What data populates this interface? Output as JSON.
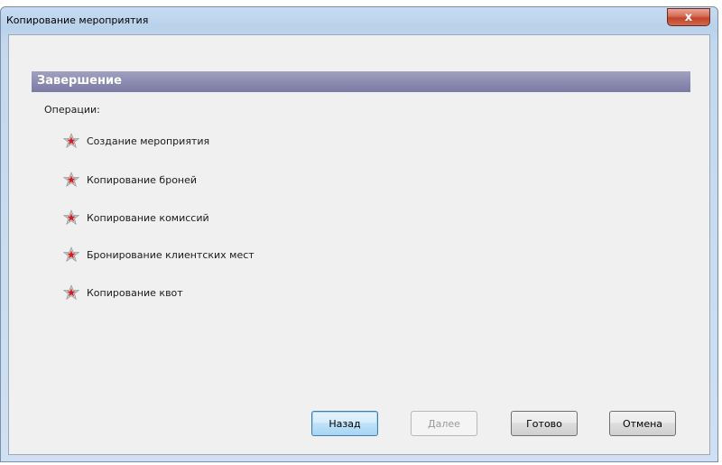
{
  "window": {
    "title": "Копирование мероприятия",
    "close_icon": "close-icon",
    "close_label": "x"
  },
  "page": {
    "header": "Завершение",
    "operations_label": "Операции:",
    "operations": [
      {
        "label": "Создание мероприятия",
        "icon": "star-icon"
      },
      {
        "label": "Копирование броней",
        "icon": "star-icon"
      },
      {
        "label": "Копирование комиссий",
        "icon": "star-icon"
      },
      {
        "label": "Бронирование клиентских мест",
        "icon": "star-icon"
      },
      {
        "label": "Копирование квот",
        "icon": "star-icon"
      }
    ]
  },
  "buttons": {
    "back": "Назад",
    "next": "Далее",
    "finish": "Готово",
    "cancel": "Отмена"
  },
  "colors": {
    "header_band": "#7a7aa4",
    "star_outer": "#c9c9c9",
    "star_inner": "#d21e1e",
    "close_button": "#c2432b"
  }
}
